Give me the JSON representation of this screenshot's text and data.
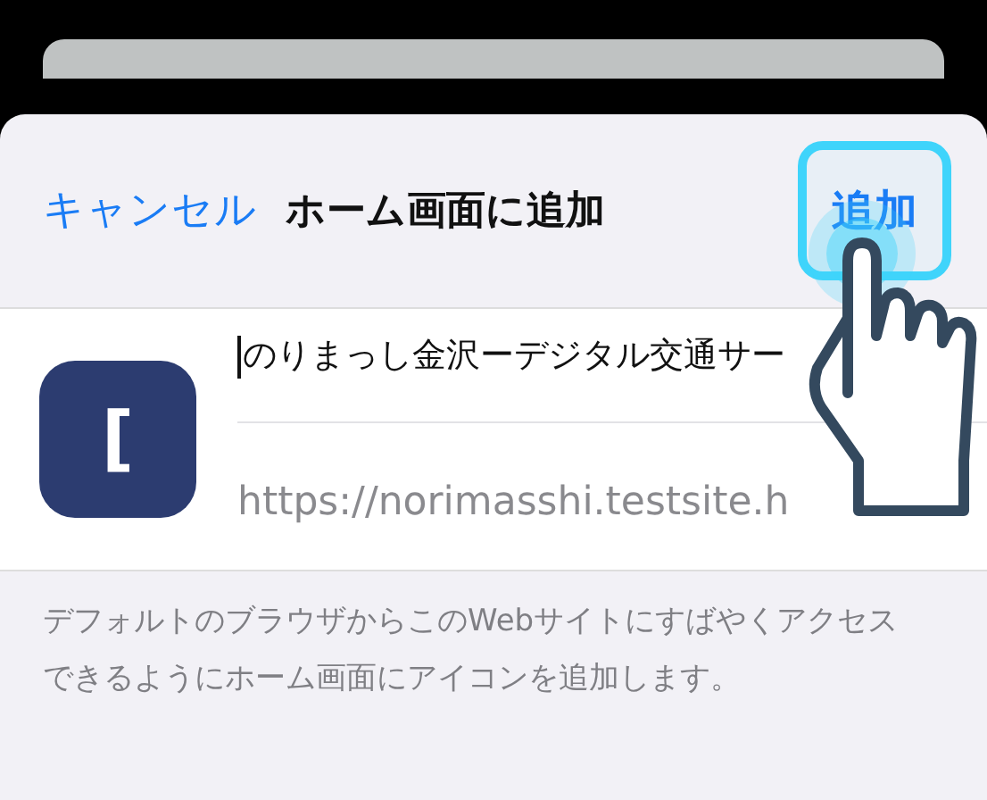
{
  "header": {
    "cancel": "キャンセル",
    "title": "ホーム画面に追加",
    "add": {
      "label": "追加",
      "highlighted": true
    }
  },
  "app_icon": {
    "glyph": "["
  },
  "name_field": {
    "value": "のりまっし金沢ーデジタル交通サー",
    "focused": true
  },
  "url": "https://norimasshi.testsite.h",
  "description": "デフォルトのブラウザからこのWebサイトにすばやくアクセスできるようにホーム画面にアイコンを追加します。",
  "tap_hint": {
    "shown": true
  }
}
